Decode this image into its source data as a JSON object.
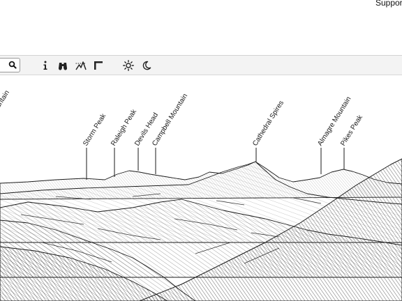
{
  "header": {
    "support_label": "Support"
  },
  "toolbar": {
    "icons": [
      "search-icon",
      "info-icon",
      "binoculars-icon",
      "elevation-icon",
      "ruler-icon",
      "sun-icon",
      "moon-icon"
    ]
  },
  "panorama": {
    "peaks": [
      {
        "name": "ountain"
      },
      {
        "name": "Storm Peak"
      },
      {
        "name": "Raleigh Peak"
      },
      {
        "name": "Devils Head"
      },
      {
        "name": "Campbell Mountain"
      },
      {
        "name": "Cathedral Spires"
      },
      {
        "name": "Almagre Mountain"
      },
      {
        "name": "Pikes Peak"
      }
    ]
  },
  "colors": {
    "ink": "#1a1a1a",
    "toolbar_bg": "#f3f3f3",
    "page_bg": "#ffffff"
  }
}
